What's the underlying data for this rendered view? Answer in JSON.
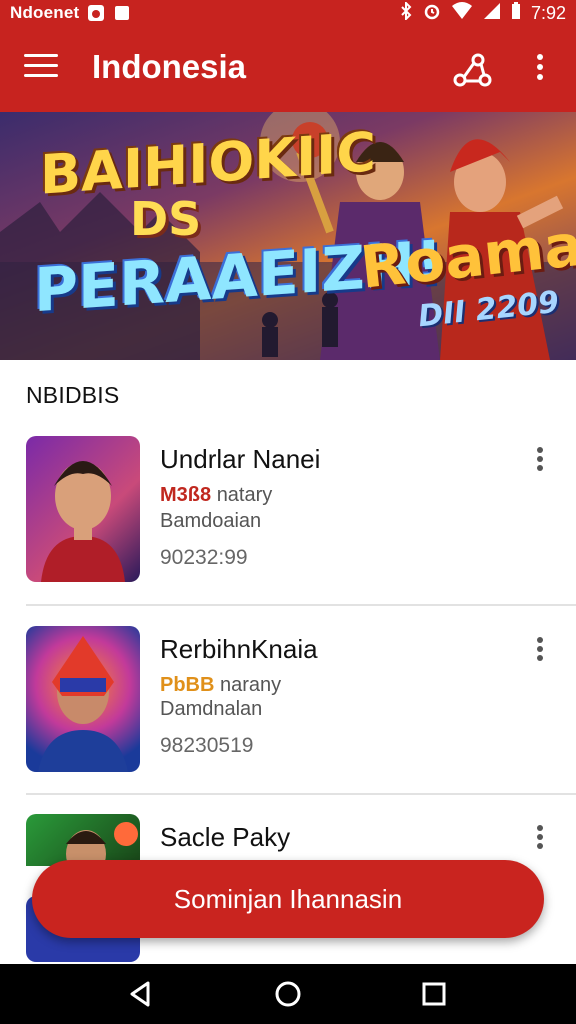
{
  "status_bar": {
    "carrier": "Ndoenet",
    "time": "7:92"
  },
  "app_bar": {
    "title": "Indonesia"
  },
  "banner": {
    "line1": "BAIHIOKIIC",
    "line2": "DS",
    "line3": "PERAAEIZH!",
    "line4": "Roaman",
    "line5": "DII 2209"
  },
  "section": {
    "title": "NBIDBIS"
  },
  "items": [
    {
      "name": "Undrlar Nanei",
      "tag": "M3ß8",
      "tag_color": "#c0281f",
      "tag_text": "natary",
      "sub": "Bamdoaian",
      "num": "90232:99"
    },
    {
      "name": "RerbihnKnaia",
      "tag": "PbBB",
      "tag_color": "#e0901a",
      "tag_text": "narany",
      "sub": "Damdnalan",
      "num": "98230519"
    },
    {
      "name": "Sacle Paky",
      "tag": "",
      "tag_color": "#555555",
      "tag_text": "",
      "sub": "",
      "num": ""
    }
  ],
  "cta": {
    "label": "Sominjan Ihannasin"
  },
  "colors": {
    "primary": "#c7231f",
    "nav": "#000000"
  },
  "icons": [
    "menu-icon",
    "share-icon",
    "more-vert-icon",
    "back-icon",
    "home-icon",
    "recents-icon"
  ]
}
